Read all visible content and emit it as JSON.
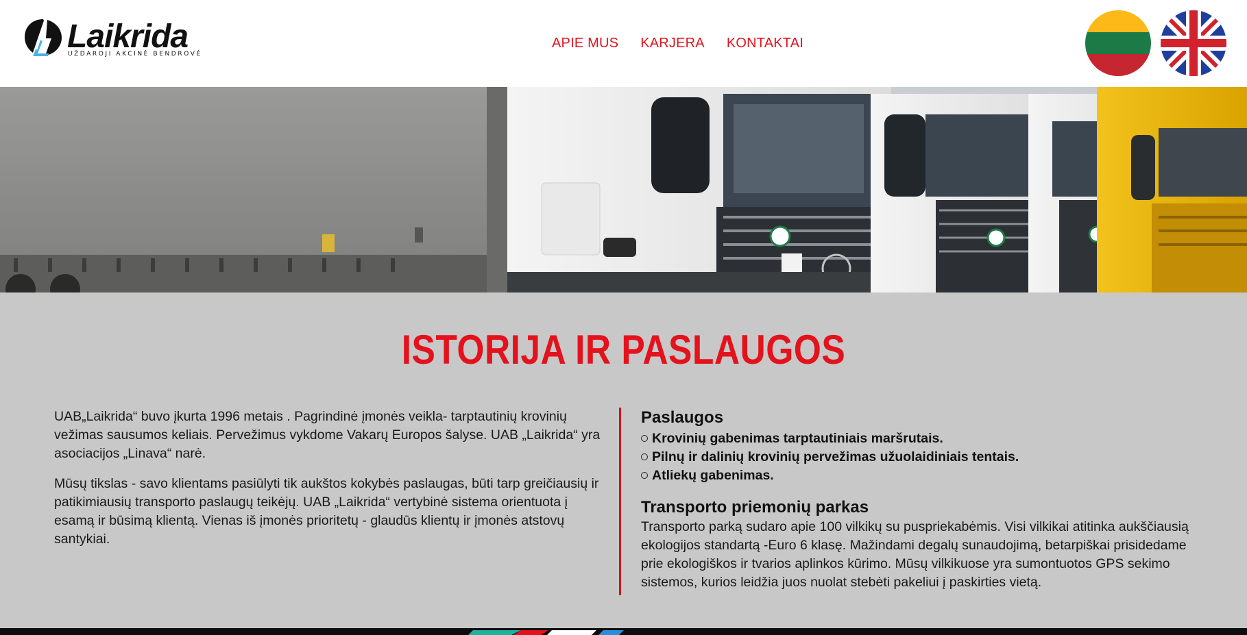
{
  "header": {
    "logo": {
      "name": "Laikrida",
      "tagline": "UŽDAROJI AKCINĖ BENDROVĖ"
    },
    "nav": [
      {
        "label": "APIE MUS"
      },
      {
        "label": "KARJERA"
      },
      {
        "label": "KONTAKTAI"
      }
    ],
    "languages": [
      "lithuanian-flag-icon",
      "uk-flag-icon"
    ]
  },
  "hero": {
    "image": "trucks-photo"
  },
  "content": {
    "title": "ISTORIJA IR PASLAUGOS",
    "left": {
      "paragraphs": [
        "UAB„Laikrida“ buvo įkurta 1996 metais . Pagrindinė įmonės veikla- tarptautinių krovinių vežimas sausumos keliais. Pervežimus vykdome Vakarų Europos šalyse. UAB „Laikrida“ yra asociacijos „Linava“ narė.",
        "Mūsų tikslas - savo klientams pasiūlyti tik aukštos kokybės paslaugas, būti tarp greičiausių ir patikimiausių transporto paslaugų teikėjų. UAB „Laikrida“ vertybinė sistema orientuota į esamą ir būsimą klientą. Vienas iš įmonės prioritetų - glaudūs klientų ir įmonės atstovų santykiai."
      ]
    },
    "right": {
      "services_title": "Paslaugos",
      "services": [
        "Krovinių gabenimas tarptautiniais maršrutais.",
        "Pilnų ir dalinių krovinių pervežimas užuolaidiniais tentais.",
        "Atliekų gabenimas."
      ],
      "fleet_title": "Transporto priemonių parkas",
      "fleet_text": "Transporto parką sudaro apie 100 vilkikų su puspriekabėmis. Visi vilkikai atitinka aukščiausią ekologijos standartą -Euro 6 klasę. Mažindami degalų sunaudojimą, betarpiškai prisidedame prie ekologiškos ir tvarios aplinkos kūrimo. Mūsų vilkikuose yra sumontuotos GPS sekimo sistemos, kurios leidžia juos nuolat stebėti pakeliui į paskirties vietą."
    }
  },
  "colors": {
    "accent": "#e3121c",
    "content_bg": "#c8c8c8",
    "text": "#1a1a1a"
  }
}
